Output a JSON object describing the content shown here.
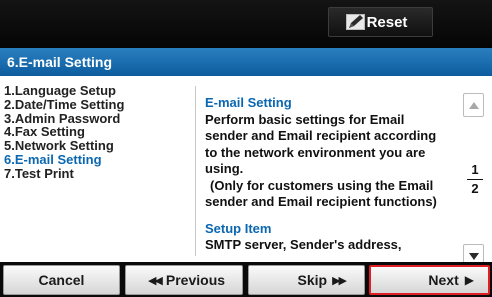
{
  "header": {
    "reset_label": "Reset",
    "reset_icon": "pencil-reset-icon"
  },
  "title": "6.E-mail Setting",
  "menu": {
    "items": [
      {
        "label": "1.Language Setup",
        "active": false
      },
      {
        "label": "2.Date/Time Setting",
        "active": false
      },
      {
        "label": "3.Admin Password",
        "active": false
      },
      {
        "label": "4.Fax Setting",
        "active": false
      },
      {
        "label": "5.Network Setting",
        "active": false
      },
      {
        "label": "6.E-mail Setting",
        "active": true
      },
      {
        "label": "7.Test Print",
        "active": false
      }
    ]
  },
  "description": {
    "heading": "E-mail Setting",
    "lines": [
      "Perform basic settings for Email",
      "sender and Email recipient according",
      "to the network environment you are",
      "using.",
      "(Only for customers using the Email",
      "sender and Email recipient functions)"
    ],
    "subheading": "Setup Item",
    "sub_lines": [
      "SMTP server, Sender's address,"
    ]
  },
  "pager": {
    "current": "1",
    "total": "2"
  },
  "footer": {
    "cancel_label": "Cancel",
    "previous_label": "Previous",
    "skip_label": "Skip",
    "next_label": "Next"
  },
  "colors": {
    "accent_blue": "#0b67b0",
    "title_bar": "#1a6fae",
    "next_highlight": "#e01e26"
  }
}
